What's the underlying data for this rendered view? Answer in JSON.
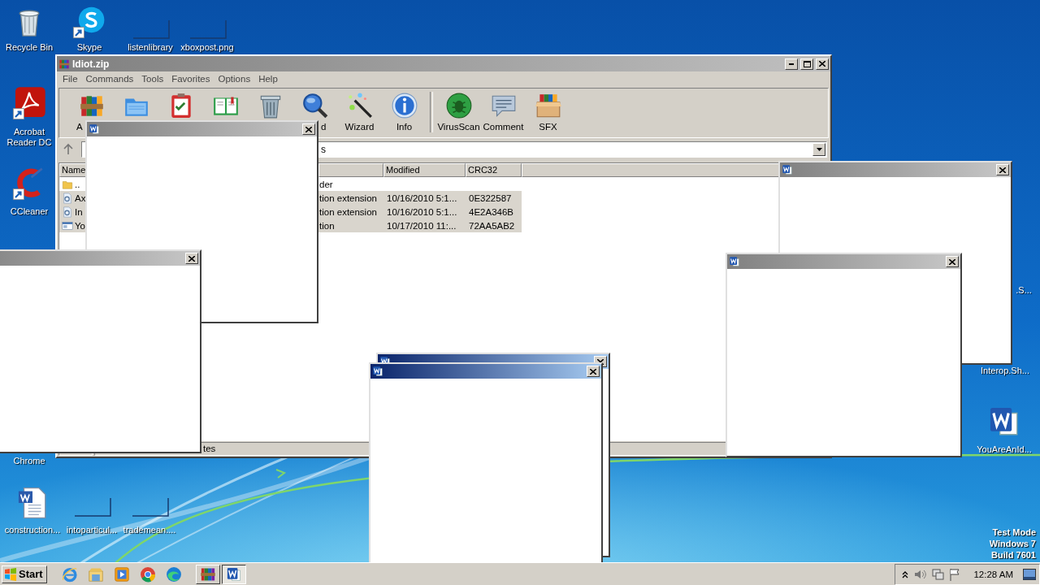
{
  "desktop": {
    "icons": [
      {
        "label": "Recycle Bin",
        "kind": "recycle"
      },
      {
        "label": "Skype",
        "kind": "skype"
      },
      {
        "label": "listenlibrary",
        "kind": "blank"
      },
      {
        "label": "xboxpost.png",
        "kind": "blank"
      },
      {
        "label": "Acrobat Reader DC",
        "kind": "acrobat"
      },
      {
        "label": "CCleaner",
        "kind": "ccleaner"
      },
      {
        "label": "Chrome",
        "kind": "hidden"
      },
      {
        "label": "construction...",
        "kind": "word-doc"
      },
      {
        "label": "intoparticul...",
        "kind": "blank"
      },
      {
        "label": "trademean....",
        "kind": "blank"
      },
      {
        "label": ".S...",
        "kind": "hidden"
      },
      {
        "label": "Interop.Sh...",
        "kind": "hidden"
      },
      {
        "label": "YouAreAnId...",
        "kind": "word"
      }
    ],
    "system_text": [
      "Test Mode",
      "Windows 7",
      "Build 7601"
    ]
  },
  "archive_window": {
    "title": "Idiot.zip",
    "menu": [
      "File",
      "Commands",
      "Tools",
      "Favorites",
      "Options",
      "Help"
    ],
    "toolbar": [
      {
        "kind": "add",
        "label": "A"
      },
      {
        "kind": "extract"
      },
      {
        "kind": "test"
      },
      {
        "kind": "view"
      },
      {
        "kind": "delete"
      },
      {
        "kind": "find",
        "label": "d"
      },
      {
        "kind": "wizard",
        "label": "Wizard"
      },
      {
        "kind": "info",
        "label": "Info"
      },
      {
        "kind": "separator"
      },
      {
        "kind": "virusscan",
        "label": "VirusScan"
      },
      {
        "kind": "comment",
        "label": "Comment"
      },
      {
        "kind": "sfx",
        "label": "SFX"
      }
    ],
    "path": "s",
    "columns": [
      "Name",
      "Modified",
      "CRC32"
    ],
    "rows": [
      {
        "kind": "folder",
        "name": "..",
        "type": "der",
        "selected": false
      },
      {
        "kind": "extension",
        "name": "Ax",
        "type": "tion extension",
        "modified": "10/16/2010 5:1...",
        "crc": "0E322587",
        "selected": true
      },
      {
        "kind": "extension",
        "name": "In",
        "type": "tion extension",
        "modified": "10/16/2010 5:1...",
        "crc": "4E2A346B",
        "selected": true
      },
      {
        "kind": "program",
        "name": "Yo",
        "type": "tion",
        "modified": "10/17/2010 11:...",
        "crc": "72AA5AB2",
        "selected": true
      }
    ],
    "status": "tes"
  },
  "popups": [
    {
      "active": false
    },
    {
      "active": false
    },
    {
      "active": false
    },
    {
      "active": false
    },
    {
      "active": true
    },
    {
      "active": true
    }
  ],
  "taskbar": {
    "start": "Start",
    "quick_launch": [
      {
        "kind": "ie"
      },
      {
        "kind": "explorer"
      },
      {
        "kind": "media"
      },
      {
        "kind": "chrome"
      },
      {
        "kind": "edge"
      }
    ],
    "tasks": [
      {
        "kind": "winrar",
        "selected": false
      },
      {
        "kind": "word",
        "selected": true
      }
    ],
    "clock": "12:28 AM"
  }
}
